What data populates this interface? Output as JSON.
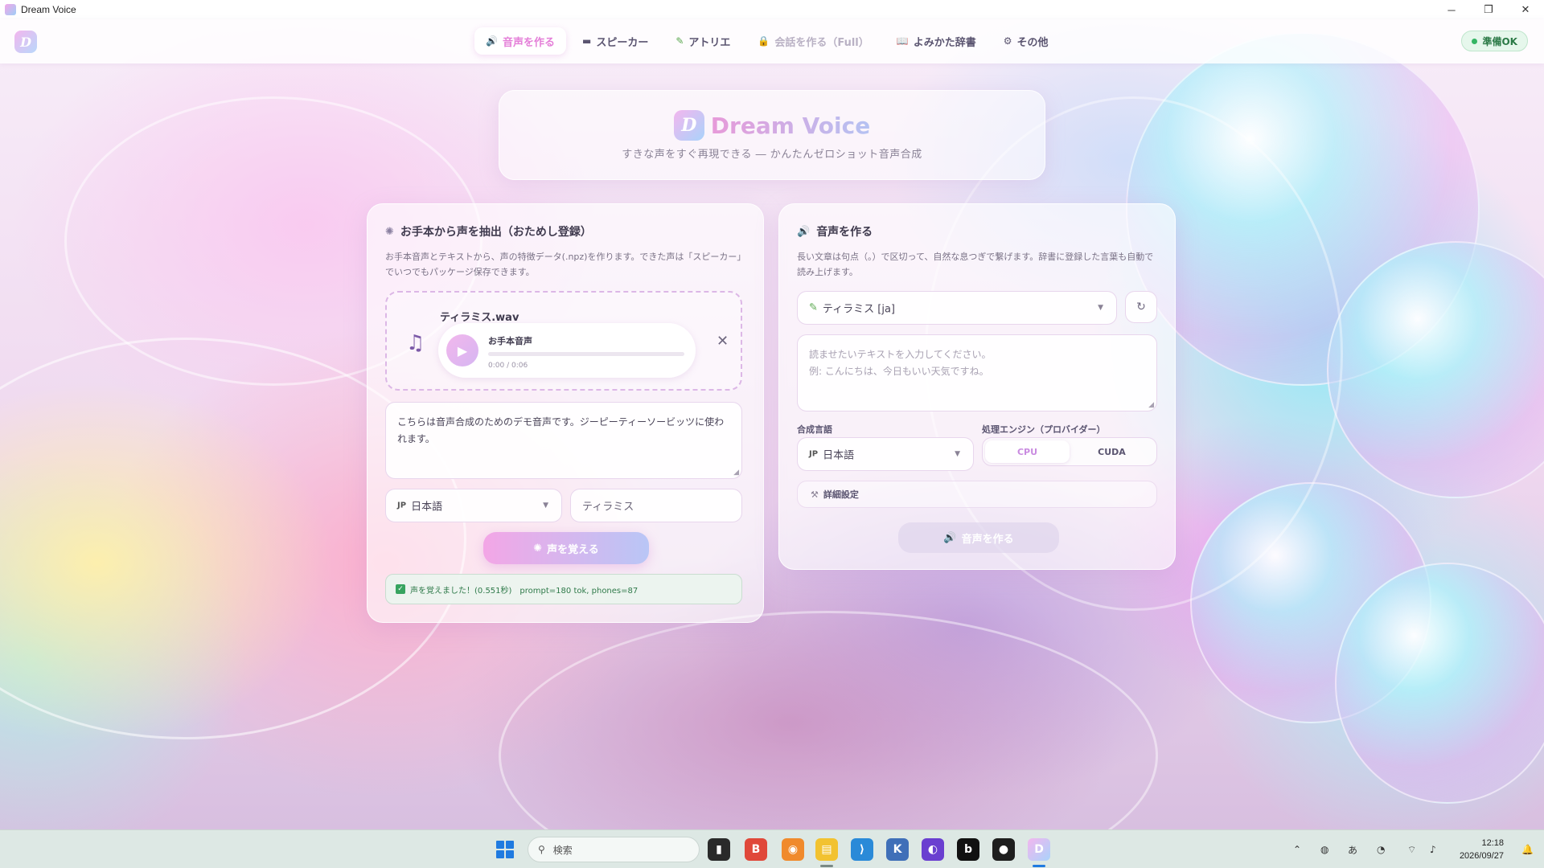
{
  "window": {
    "title": "Dream Voice"
  },
  "nav": {
    "tabs": [
      {
        "icon": "speaker-icon",
        "glyph": "🔊",
        "label": "音声を作る",
        "state": "active"
      },
      {
        "icon": "folder-icon",
        "glyph": "▬",
        "label": "スピーカー",
        "state": "normal"
      },
      {
        "icon": "pencil-icon",
        "glyph": "✎",
        "label": "アトリエ",
        "state": "normal"
      },
      {
        "icon": "lock-icon",
        "glyph": "🔒",
        "label": "会話を作る（Full）",
        "state": "disabled"
      },
      {
        "icon": "book-icon",
        "glyph": "📖",
        "label": "よみかた辞書",
        "state": "normal"
      },
      {
        "icon": "tool-icon",
        "glyph": "⚙",
        "label": "その他",
        "state": "normal"
      }
    ],
    "status_badge": "準備OK"
  },
  "hero": {
    "title": "Dream Voice",
    "subtitle": "すきな声をすぐ再現できる ― かんたんゼロショット音声合成"
  },
  "extract_panel": {
    "title": "お手本から声を抽出（おためし登録）",
    "description": "お手本音声とテキストから、声の特徴データ(.npz)を作ります。できた声は「スピーカー」でいつでもパッケージ保存できます。",
    "file_name": "ティラミス.wav",
    "player": {
      "title": "お手本音声",
      "time": "0:00 / 0:06",
      "progress": 0
    },
    "transcript": "こちらは音声合成のためのデモ音声です。ジーピーティーソービッツに使われます。",
    "language": {
      "prefix": "JP",
      "value": "日本語"
    },
    "speaker_name": "ティラミス",
    "submit_label": "声を覚える",
    "status": "声を覚えました！(0.551秒)　prompt=180 tok, phones=87"
  },
  "synth_panel": {
    "title": "音声を作る",
    "description": "長い文章は句点（。）で区切って、自然な息つぎで繋げます。辞書に登録した言葉も自動で読み上げます。",
    "speaker": "ティラミス [ja]",
    "text_placeholder_line1": "読ませたいテキストを入力してください。",
    "text_placeholder_line2": "例: こんにちは、今日もいい天気ですね。",
    "language_label": "合成言語",
    "language": {
      "prefix": "JP",
      "value": "日本語"
    },
    "engine_label": "処理エンジン（プロバイダー）",
    "engine_options": [
      "CPU",
      "CUDA"
    ],
    "engine_selected": "CPU",
    "details_label": "詳細設定",
    "submit_label": "音声を作る"
  },
  "taskbar": {
    "search_placeholder": "検索",
    "time": "12:18",
    "date": "2026/09/27"
  },
  "colors": {
    "accent_pink": "#e47fd8",
    "success_green": "#37a35f",
    "status_text": "#2f7a4a"
  }
}
